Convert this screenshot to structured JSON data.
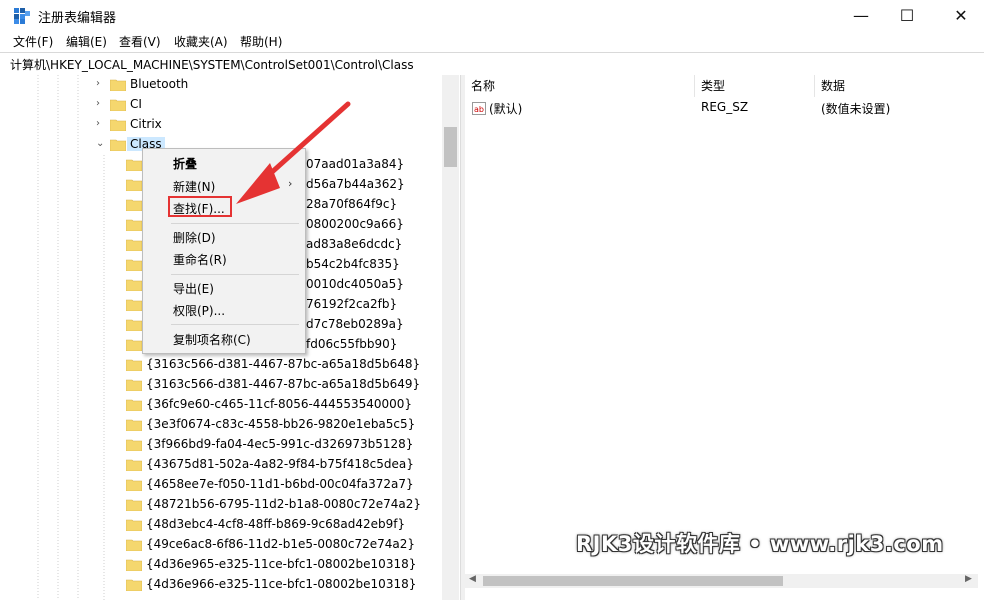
{
  "window": {
    "title": "注册表编辑器"
  },
  "window_controls": {
    "minimize": "—",
    "maximize": "☐",
    "close": "✕"
  },
  "menu": [
    "文件(F)",
    "编辑(E)",
    "查看(V)",
    "收藏夹(A)",
    "帮助(H)"
  ],
  "address": "计算机\\HKEY_LOCAL_MACHINE\\SYSTEM\\ControlSet001\\Control\\Class",
  "tree": {
    "top_nodes": [
      "Bluetooth",
      "CI",
      "Citrix",
      "Class"
    ],
    "visible_children": [
      "{3163c566-d381-4467-87bc-a65a18d5b648}",
      "{3163c566-d381-4467-87bc-a65a18d5b649}",
      "{36fc9e60-c465-11cf-8056-444553540000}",
      "{3e3f0674-c83c-4558-bb26-9820e1eba5c5}",
      "{3f966bd9-fa04-4ec5-991c-d326973b5128}",
      "{43675d81-502a-4a82-9f84-b75f418c5dea}",
      "{4658ee7e-f050-11d1-b6bd-00c04fa372a7}",
      "{48721b56-6795-11d2-b1a8-0080c72e74a2}",
      "{48d3ebc4-4cf8-48ff-b869-9c68ad42eb9f}",
      "{49ce6ac8-6f86-11d2-b1e5-0080c72e74a2}",
      "{4d36e965-e325-11ce-bfc1-08002be10318}",
      "{4d36e966-e325-11ce-bfc1-08002be10318}"
    ],
    "obscured_children": [
      "07aad01a3a84}",
      "d56a7b44a362}",
      "28a70f864f9c}",
      "0800200c9a66}",
      "ad83a8e6dcdc}",
      "b54c2b4fc835}",
      "0010dc4050a5}",
      "76192f2ca2fb}",
      "d7c78eb0289a}",
      "fd06c55fbb90}"
    ]
  },
  "values": {
    "headers": [
      "名称",
      "类型",
      "数据"
    ],
    "rows": [
      {
        "name": "(默认)",
        "type": "REG_SZ",
        "data": "(数值未设置)",
        "icon": "ab-icon"
      }
    ]
  },
  "context_menu": {
    "items": [
      "折叠",
      "新建(N)",
      "查找(F)...",
      "删除(D)",
      "重命名(R)",
      "导出(E)",
      "权限(P)...",
      "复制项名称(C)"
    ],
    "submenu_arrow": "›"
  },
  "watermark": "RJK3设计软件库 • www.rjk3.com",
  "colors": {
    "selection": "#cce8ff",
    "annotation": "#e53333",
    "folder": "#f5d76e"
  }
}
